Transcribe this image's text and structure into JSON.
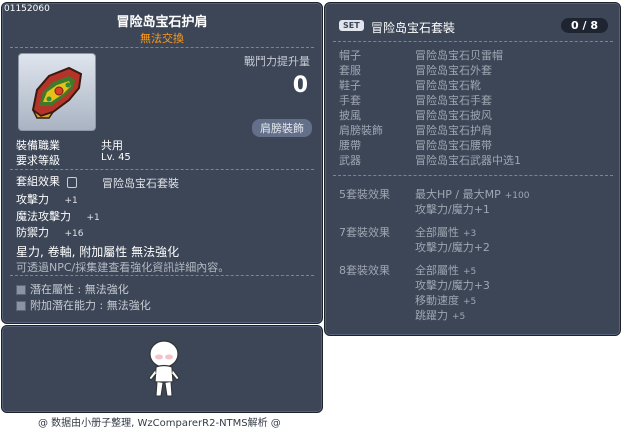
{
  "item": {
    "id": "01152060",
    "name": "冒险岛宝石护肩",
    "trade": "無法交換",
    "power_label": "戰鬥力提升量",
    "power_value": "0",
    "slot_badge": "肩膀裝飾",
    "job_label": "裝備職業",
    "job_value": "共用",
    "level_label": "要求等級",
    "level_value": "Lv. 45",
    "set_label": "套組效果",
    "set_value": "冒险岛宝石套裝",
    "stats": [
      {
        "label": "攻擊力",
        "value": "+1"
      },
      {
        "label": "魔法攻擊力",
        "value": "+1"
      },
      {
        "label": "防禦力",
        "value": "+16"
      }
    ],
    "flags": "星力, 卷軸, 附加屬性 無法強化",
    "hint": "可透過NPC/採集建查看強化資訊詳細內容。",
    "potential_label": "潛在屬性",
    "potential_value": "無法強化",
    "bonus_potential_label": "附加潛在能力",
    "bonus_potential_value": "無法強化"
  },
  "set": {
    "badge": "SET",
    "title": "冒险岛宝石套裝",
    "count": "0 / 8",
    "pieces": [
      {
        "slot": "帽子",
        "name": "冒险岛宝石贝雷帽"
      },
      {
        "slot": "套服",
        "name": "冒险岛宝石外套"
      },
      {
        "slot": "鞋子",
        "name": "冒险岛宝石靴"
      },
      {
        "slot": "手套",
        "name": "冒险岛宝石手套"
      },
      {
        "slot": "披風",
        "name": "冒险岛宝石披风"
      },
      {
        "slot": "肩膀裝飾",
        "name": "冒险岛宝石护肩"
      },
      {
        "slot": "腰帶",
        "name": "冒险岛宝石腰带"
      },
      {
        "slot": "武器",
        "name": "冒险岛宝石武器中选1"
      }
    ],
    "effects": [
      {
        "header": "5套裝效果",
        "lines": [
          {
            "text": "最大HP / 最大MP",
            "num": "+100"
          },
          {
            "text": "攻擊力/魔力+1",
            "num": ""
          }
        ]
      },
      {
        "header": "7套裝效果",
        "lines": [
          {
            "text": "全部屬性",
            "num": "+3"
          },
          {
            "text": "攻擊力/魔力+2",
            "num": ""
          }
        ]
      },
      {
        "header": "8套裝效果",
        "lines": [
          {
            "text": "全部屬性",
            "num": "+5"
          },
          {
            "text": "攻擊力/魔力+3",
            "num": ""
          },
          {
            "text": "移動速度",
            "num": "+5"
          },
          {
            "text": "跳躍力",
            "num": "+5"
          }
        ]
      }
    ]
  },
  "footer": "@ 数据由小册子整理, WzComparerR2-NTMS解析 @",
  "colors": {
    "trade": "#ff9a1a",
    "panel": "#3c4657"
  },
  "icons": {
    "item": "shoulder-armor-icon",
    "character": "character-preview-icon",
    "lock": "lock-icon"
  }
}
